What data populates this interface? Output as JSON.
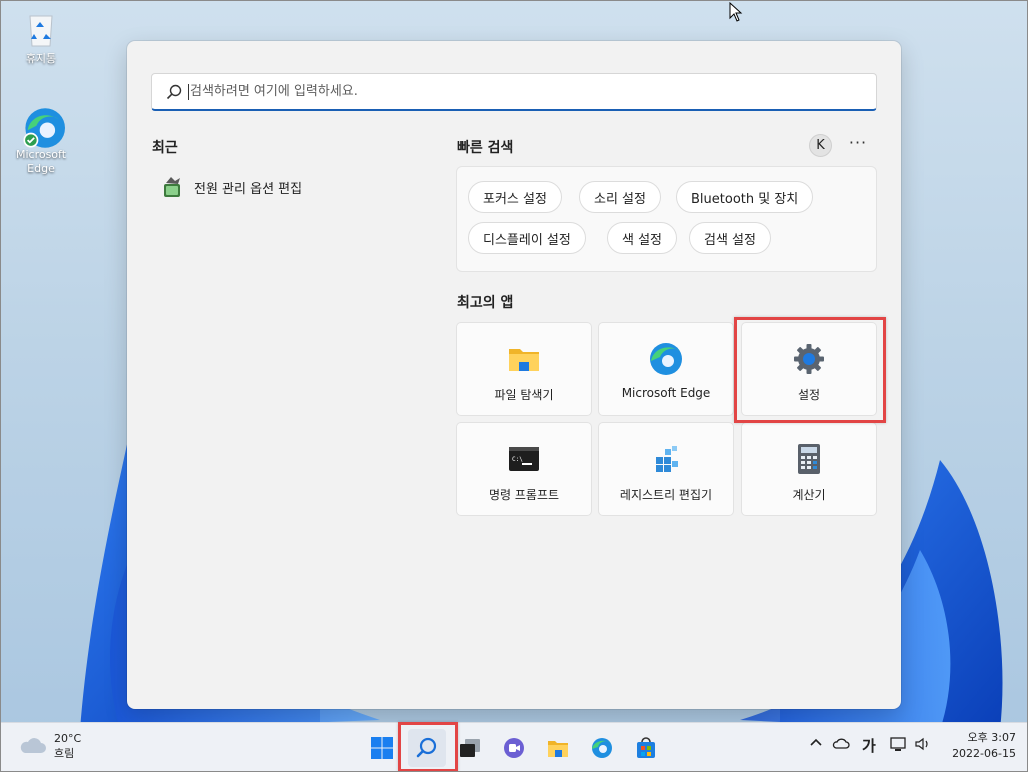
{
  "desktop": {
    "icons": [
      {
        "label": "휴지통",
        "icon": "recycle-bin-icon"
      },
      {
        "label": "Microsoft Edge",
        "icon": "edge-icon"
      }
    ]
  },
  "search": {
    "placeholder": "검색하려면 여기에 입력하세요."
  },
  "recent": {
    "title": "최근",
    "items": [
      {
        "label": "전원 관리 옵션 편집",
        "icon": "power-options-icon"
      }
    ]
  },
  "quick_search": {
    "title": "빠른 검색",
    "avatar": "K",
    "more": "···",
    "chips": [
      "포커스 설정",
      "소리 설정",
      "Bluetooth 및 장치",
      "디스플레이 설정",
      "색 설정",
      "검색 설정"
    ]
  },
  "top_apps": {
    "title": "최고의 앱",
    "items": [
      {
        "label": "파일 탐색기",
        "icon": "folder-icon"
      },
      {
        "label": "Microsoft Edge",
        "icon": "edge-icon"
      },
      {
        "label": "설정",
        "icon": "gear-icon",
        "highlighted": true
      },
      {
        "label": "명령 프롬프트",
        "icon": "terminal-icon"
      },
      {
        "label": "레지스트리 편집기",
        "icon": "registry-icon"
      },
      {
        "label": "계산기",
        "icon": "calculator-icon"
      }
    ]
  },
  "taskbar": {
    "weather": {
      "temp": "20°C",
      "condition": "흐림"
    },
    "apps": [
      "start-icon",
      "search-icon",
      "task-view-icon",
      "chat-icon",
      "file-explorer-icon",
      "edge-icon",
      "store-icon"
    ],
    "search_highlighted": true,
    "tray": {
      "ime": "가"
    },
    "clock": {
      "time": "오후 3:07",
      "date": "2022-06-15"
    }
  },
  "colors": {
    "accent": "#1a5fb4",
    "highlight": "#e24545"
  }
}
